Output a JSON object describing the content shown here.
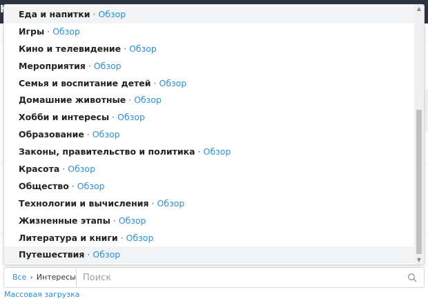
{
  "header": {
    "partial_char": "Н"
  },
  "dropdown": {
    "separator": "·",
    "items": [
      {
        "name": "Еда и напитки",
        "action": "Обзор"
      },
      {
        "name": "Игры",
        "action": "Обзор"
      },
      {
        "name": "Кино и телевидение",
        "action": "Обзор"
      },
      {
        "name": "Мероприятия",
        "action": "Обзор"
      },
      {
        "name": "Семья и воспитание детей",
        "action": "Обзор"
      },
      {
        "name": "Домашние животные",
        "action": "Обзор"
      },
      {
        "name": "Хобби и интересы",
        "action": "Обзор"
      },
      {
        "name": "Образование",
        "action": "Обзор"
      },
      {
        "name": "Законы, правительство и политика",
        "action": "Обзор"
      },
      {
        "name": "Красота",
        "action": "Обзор"
      },
      {
        "name": "Общество",
        "action": "Обзор"
      },
      {
        "name": "Технологии и вычисления",
        "action": "Обзор"
      },
      {
        "name": "Жизненные этапы",
        "action": "Обзор"
      },
      {
        "name": "Литература и книги",
        "action": "Обзор"
      },
      {
        "name": "Путешествия",
        "action": "Обзор"
      }
    ],
    "hovered_indices": [
      0,
      14
    ]
  },
  "search": {
    "crumb_all": "Все",
    "crumb_current": "Интересы",
    "placeholder": "Поиск",
    "value": ""
  },
  "footer": {
    "bulk_upload": "Массовая загрузка"
  },
  "colors": {
    "link": "#2b8fd6",
    "text": "#222222",
    "border": "#d6d9dd",
    "topbar": "#2b3440"
  },
  "icons": {
    "search": "magnifier-icon",
    "crumb_separator": "chevron-right-icon",
    "scroll_up": "triangle-up-icon",
    "scroll_down": "triangle-down-icon"
  }
}
